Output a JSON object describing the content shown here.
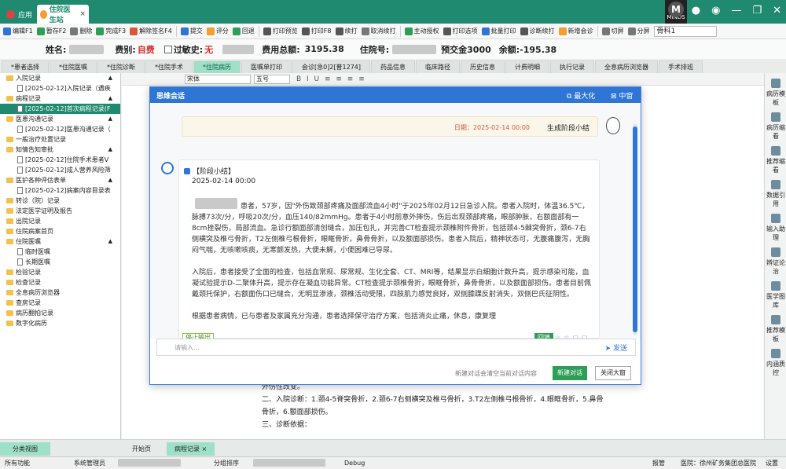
{
  "titlebar": {
    "app_tab": "应用",
    "active_tab": "住院医生站",
    "brand": "MINDS",
    "close_glyph": "×"
  },
  "toolbar": {
    "items": [
      "编辑F1",
      "暂存F2",
      "删除",
      "完成F3",
      "解除签名F4",
      "提交",
      "评分",
      "回退",
      "打印预览",
      "打印F8",
      "续打",
      "取消续打",
      "主动授权",
      "打印选项",
      "批量打印",
      "诊断续打",
      "新增会诊",
      "切屏",
      "分屏"
    ],
    "dept_value": "骨科1"
  },
  "patient": {
    "name_label": "姓名:",
    "fee_label": "费别:",
    "fee_value": "自费",
    "allergy_label": "过敏史:",
    "allergy_value": "无",
    "total_label": "费用总额:",
    "total_value": "3195.38",
    "admission_label": "住院号:",
    "prepay_label": "预交金3000",
    "balance_label": "余额:-195.38"
  },
  "tabs": [
    "*患者选择",
    "*住院医嘱",
    "*住院诊断",
    "*住院手术",
    "*住院病历",
    "医嘱单打印",
    "会诊[急0]2[普1274]",
    "药品信息",
    "临床路径",
    "历史信息",
    "计费明细",
    "执行记录",
    "全息病历浏览器",
    "手术排班"
  ],
  "active_tab_index": 4,
  "tree": [
    {
      "level": 1,
      "type": "folder",
      "label": "入院记录",
      "arrow": "▲"
    },
    {
      "level": 2,
      "type": "doc",
      "label": "[2025-02-12]入院记录（遇疾"
    },
    {
      "level": 1,
      "type": "folder",
      "label": "病程记录",
      "arrow": "▲"
    },
    {
      "level": 2,
      "type": "doc",
      "label": "[2025-02-12]首次病程记录(F",
      "selected": true
    },
    {
      "level": 1,
      "type": "folder",
      "label": "医患沟通记录",
      "arrow": "▲"
    },
    {
      "level": 2,
      "type": "doc",
      "label": "[2025-02-12]医患沟通记录（"
    },
    {
      "level": 1,
      "type": "folder",
      "label": "一般治疗处置记录"
    },
    {
      "level": 1,
      "type": "folder",
      "label": "知情告知审批",
      "arrow": "▲"
    },
    {
      "level": 2,
      "type": "doc",
      "label": "[2025-02-12]住院手术患者V"
    },
    {
      "level": 2,
      "type": "doc",
      "label": "[2025-02-12]成人营养风险筛"
    },
    {
      "level": 1,
      "type": "folder",
      "label": "医护各种评估表单",
      "arrow": "▲"
    },
    {
      "level": 2,
      "type": "doc",
      "label": "[2025-02-12]病案内容目录表"
    },
    {
      "level": 1,
      "type": "folder",
      "label": "转诊（院）记录"
    },
    {
      "level": 1,
      "type": "folder",
      "label": "法定医学证明及报告"
    },
    {
      "level": 1,
      "type": "folder",
      "label": "出院记录"
    },
    {
      "level": 1,
      "type": "folder",
      "label": "住院病案首页"
    },
    {
      "level": 1,
      "type": "folder",
      "label": "住院医嘱",
      "arrow": "▲"
    },
    {
      "level": 2,
      "type": "doc",
      "label": "临时医嘱"
    },
    {
      "level": 2,
      "type": "doc",
      "label": "长期医嘱"
    },
    {
      "level": 1,
      "type": "folder",
      "label": "检验记录"
    },
    {
      "level": 1,
      "type": "folder",
      "label": "检查记录"
    },
    {
      "level": 1,
      "type": "folder",
      "label": "全息病历浏览器"
    },
    {
      "level": 1,
      "type": "folder",
      "label": "查房记录"
    },
    {
      "level": 1,
      "type": "folder",
      "label": "病历翻拍记录"
    },
    {
      "level": 1,
      "type": "folder",
      "label": "数字化病历"
    }
  ],
  "editor": {
    "font_select": "宋体",
    "size_select": "五号",
    "doc_lines": [
      "外伤性改变。",
      "二、入院诊断：1.颈4-5脊突骨折，2.颈6-7右侧横突及椎弓骨折，3.T2左侧椎弓根骨折，4.眼眶骨折，5.鼻骨",
      "骨折，6.额面部损伤。",
      "三、诊断依据："
    ]
  },
  "right_panel": [
    "病历模板",
    "病历缩看",
    "推荐缩看",
    "数据引用",
    "输入助理",
    "辨证论治",
    "医学图库",
    "推荐模板",
    "内涵质控"
  ],
  "dialog": {
    "title": "思维会话",
    "max_label": "最大化",
    "mid_label": "中窗",
    "user_date": "日期：2025-02-14 00:00",
    "user_text": "生成阶段小结",
    "bot_title": "【阶段小结】",
    "bot_date": "2025-02-14 00:00",
    "paragraphs": [
      "患者，57岁，因\"外伤致颈部疼痛及面部流血4小时\"于2025年02月12日急诊入院。患者入院时，体温36.5℃，脉搏73次/分，呼吸20次/分，血压140/82mmHg。患者于4小时前意外摔伤，伤后出现颈部疼痛，眼部肿胀，右额面部有一8cm挫裂伤，局部流血。急诊行额面部清创缝合，加压包扎，并完善CT检查提示颈椎附件骨折，包括颈4-5棘突骨折，颈6-7右侧横突及椎弓骨折，T2左侧椎弓根骨折，眼眶骨折，鼻骨骨折，以及额面部损伤。患者入院后，精神状态可，无腹痛腹泻，无胸闷气喘，无咳嗽咳痰，无寒颤发热，大便未解，小便困难已导尿。",
      "入院后，患者接受了全面的检查，包括血常规、尿常规、生化全套、CT、MRI等，结果显示白细胞计数升高，提示感染可能，血凝试验提示D-二聚体升高，提示存在凝血功能异常。CT检查提示颈椎骨折，眼眶骨折，鼻骨骨折，以及额面部损伤。患者目前佩戴颈托保护，右额面伤口已缝合，无明显渗液，颈椎活动受限，四肢肌力感觉良好，双侧膝踝反射消失，双侧巴氏征阴性。",
      "根据患者病情，已与患者及家属充分沟通，患者选择保守治疗方案，包括消炎止痛，休息，康复理"
    ],
    "stop_label": "停止输出",
    "apply_label": "回填",
    "input_placeholder": "请输入...",
    "send_label": "发送",
    "hint": "新建对话会清空当前对话内容",
    "new_label": "新建对话",
    "close_label": "关闭大窗"
  },
  "bottom": {
    "left_tab": "分类视图",
    "tab_start": "开始页",
    "tab_record": "病程记录",
    "tab_record_close": "×"
  },
  "status": {
    "msg": "所有功能",
    "user": "系统管理员",
    "group": "分组排序",
    "debug": "Debug",
    "mode": "报管",
    "hospital": "医院：徐州矿务集团总医院",
    "settings": "设置"
  },
  "colors": {
    "brand_green": "#1f8a6f",
    "dialog_blue": "#2f75d6",
    "accent_red": "#d32f2f"
  }
}
